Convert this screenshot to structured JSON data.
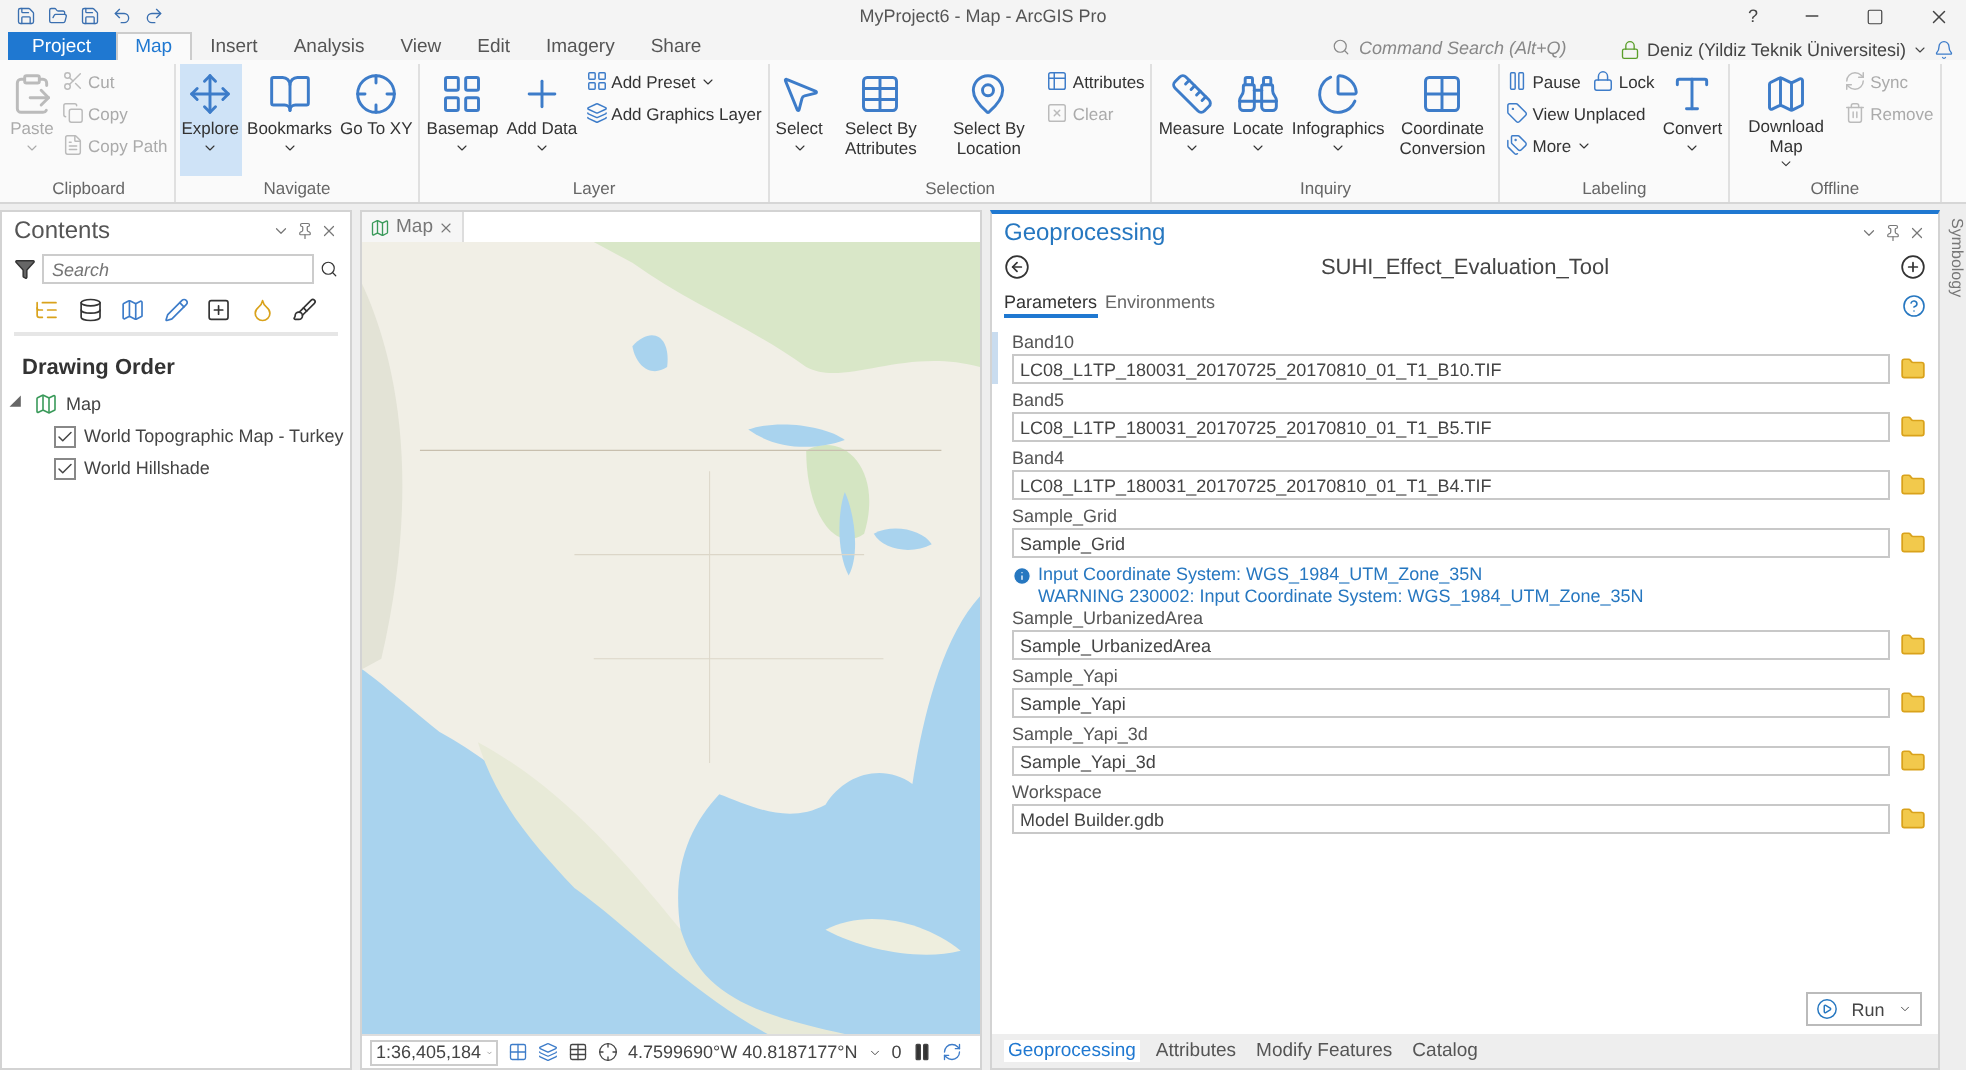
{
  "window": {
    "title": "MyProject6 - Map - ArcGIS Pro",
    "help": "?"
  },
  "ribbon_tabs": [
    {
      "label": "Project",
      "kind": "backstage",
      "selected": false
    },
    {
      "label": "Map",
      "kind": "tab",
      "selected": true
    },
    {
      "label": "Insert",
      "kind": "tab",
      "selected": false
    },
    {
      "label": "Analysis",
      "kind": "tab",
      "selected": false
    },
    {
      "label": "View",
      "kind": "tab",
      "selected": false
    },
    {
      "label": "Edit",
      "kind": "tab",
      "selected": false
    },
    {
      "label": "Imagery",
      "kind": "tab",
      "selected": false
    },
    {
      "label": "Share",
      "kind": "tab",
      "selected": false
    }
  ],
  "command_search": {
    "placeholder": "Command Search (Alt+Q)"
  },
  "user": "Deniz (Yildiz Teknik Üniversitesi)",
  "ribbon_groups": [
    {
      "label": "Clipboard",
      "items": [
        {
          "kind": "large",
          "label": "Paste",
          "disabled": true,
          "active": false,
          "dropdown": true
        },
        {
          "kind": "stack",
          "rows": [
            [
              {
                "label": "Cut",
                "disabled": true,
                "active": false,
                "dropdown": false
              }
            ],
            [
              {
                "label": "Copy",
                "disabled": true,
                "active": false,
                "dropdown": false
              }
            ],
            [
              {
                "label": "Copy Path",
                "disabled": true,
                "active": false,
                "dropdown": false
              }
            ]
          ]
        }
      ]
    },
    {
      "label": "Navigate",
      "items": [
        {
          "kind": "large",
          "label": "Explore",
          "disabled": false,
          "active": true,
          "dropdown": true
        },
        {
          "kind": "large",
          "label": "Bookmarks",
          "disabled": false,
          "active": false,
          "dropdown": true
        },
        {
          "kind": "large",
          "label": "Go To XY",
          "disabled": false,
          "active": false,
          "dropdown": false
        }
      ]
    },
    {
      "label": "Layer",
      "items": [
        {
          "kind": "large",
          "label": "Basemap",
          "disabled": false,
          "active": false,
          "dropdown": true
        },
        {
          "kind": "large",
          "label": "Add Data",
          "disabled": false,
          "active": false,
          "dropdown": true
        },
        {
          "kind": "stack",
          "rows": [
            [
              {
                "label": "Add Preset",
                "disabled": false,
                "active": false,
                "dropdown": true
              }
            ],
            [
              {
                "label": "Add Graphics Layer",
                "disabled": false,
                "active": false,
                "dropdown": false
              }
            ]
          ]
        }
      ]
    },
    {
      "label": "Selection",
      "items": [
        {
          "kind": "large",
          "label": "Select",
          "disabled": false,
          "active": false,
          "dropdown": true
        },
        {
          "kind": "large",
          "label": "Select By Attributes",
          "disabled": false,
          "active": false,
          "dropdown": false
        },
        {
          "kind": "large",
          "label": "Select By Location",
          "disabled": false,
          "active": false,
          "dropdown": false
        },
        {
          "kind": "stack",
          "rows": [
            [
              {
                "label": "Attributes",
                "disabled": false,
                "active": false,
                "dropdown": false
              }
            ],
            [
              {
                "label": "Clear",
                "disabled": true,
                "active": false,
                "dropdown": false
              }
            ]
          ]
        }
      ]
    },
    {
      "label": "Inquiry",
      "items": [
        {
          "kind": "large",
          "label": "Measure",
          "disabled": false,
          "active": false,
          "dropdown": true
        },
        {
          "kind": "large",
          "label": "Locate",
          "disabled": false,
          "active": false,
          "dropdown": true
        },
        {
          "kind": "large",
          "label": "Infographics",
          "disabled": false,
          "active": false,
          "dropdown": true
        },
        {
          "kind": "large",
          "label": "Coordinate Conversion",
          "disabled": false,
          "active": false,
          "dropdown": false
        }
      ]
    },
    {
      "label": "Labeling",
      "items": [
        {
          "kind": "stack",
          "rows": [
            [
              {
                "label": "Pause",
                "disabled": false,
                "active": false,
                "dropdown": false
              },
              {
                "label": "Lock",
                "disabled": false,
                "active": false,
                "dropdown": false
              }
            ],
            [
              {
                "label": "View Unplaced",
                "disabled": false,
                "active": false,
                "dropdown": false
              }
            ],
            [
              {
                "label": "More",
                "disabled": false,
                "active": false,
                "dropdown": true
              }
            ]
          ]
        },
        {
          "kind": "large",
          "label": "Convert",
          "disabled": false,
          "active": false,
          "dropdown": true
        }
      ]
    },
    {
      "label": "Offline",
      "items": [
        {
          "kind": "large",
          "label": "Download Map",
          "disabled": false,
          "active": false,
          "dropdown": true
        },
        {
          "kind": "stack",
          "rows": [
            [
              {
                "label": "Sync",
                "disabled": true,
                "active": false,
                "dropdown": false
              }
            ],
            [
              {
                "label": "Remove",
                "disabled": true,
                "active": false,
                "dropdown": false
              }
            ]
          ]
        }
      ]
    }
  ],
  "contents": {
    "title": "Contents",
    "search": {
      "placeholder": "Search"
    },
    "heading": "Drawing Order",
    "tree": [
      {
        "label": "Map",
        "expanded": true,
        "children": [
          {
            "label": "World Topographic Map - Turkey",
            "checked": true
          },
          {
            "label": "World Hillshade",
            "checked": true
          }
        ]
      }
    ]
  },
  "map_view": {
    "tab": "Map",
    "status_bar": {
      "scale": "1:36,405,184",
      "coordinates": "4.7599690°W 40.8187177°N",
      "selected_count": "0"
    }
  },
  "geoprocessing": {
    "title": "Geoprocessing",
    "tool_name": "SUHI_Effect_Evaluation_Tool",
    "tabs": [
      {
        "label": "Parameters",
        "selected": true
      },
      {
        "label": "Environments",
        "selected": false
      }
    ],
    "parameters": [
      {
        "label": "Band10",
        "value": "LC08_L1TP_180031_20170725_20170810_01_T1_B10.TIF",
        "selected": true
      },
      {
        "label": "Band5",
        "value": "LC08_L1TP_180031_20170725_20170810_01_T1_B5.TIF",
        "selected": false
      },
      {
        "label": "Band4",
        "value": "LC08_L1TP_180031_20170725_20170810_01_T1_B4.TIF",
        "selected": false
      },
      {
        "label": "Sample_Grid",
        "value": "Sample_Grid",
        "selected": false,
        "messages": [
          {
            "kind": "info",
            "text": "Input Coordinate System: WGS_1984_UTM_Zone_35N"
          },
          {
            "kind": "warning",
            "text": "WARNING 230002: Input Coordinate System: WGS_1984_UTM_Zone_35N"
          }
        ]
      },
      {
        "label": "Sample_UrbanizedArea",
        "value": "Sample_UrbanizedArea",
        "selected": false
      },
      {
        "label": "Sample_Yapi",
        "value": "Sample_Yapi",
        "selected": false
      },
      {
        "label": "Sample_Yapi_3d",
        "value": "Sample_Yapi_3d",
        "selected": false
      },
      {
        "label": "Workspace",
        "value": "Model Builder.gdb",
        "selected": false
      }
    ],
    "run_button": "Run",
    "bottom_tabs": [
      {
        "label": "Geoprocessing",
        "selected": true
      },
      {
        "label": "Attributes",
        "selected": false
      },
      {
        "label": "Modify Features",
        "selected": false
      },
      {
        "label": "Catalog",
        "selected": false
      }
    ]
  },
  "side_tab": "Symbology"
}
